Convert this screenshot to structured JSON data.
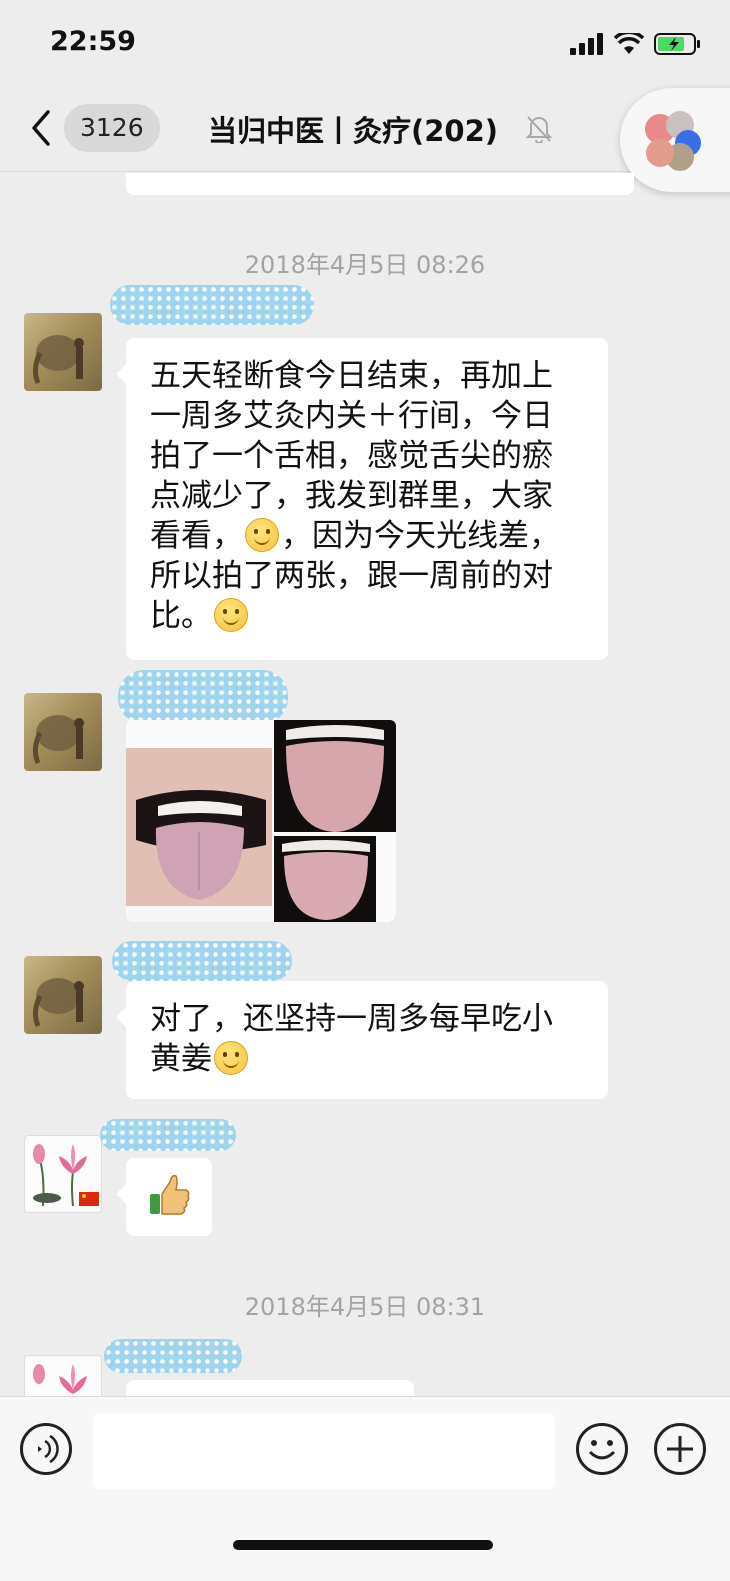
{
  "status_bar": {
    "time": "22:59"
  },
  "nav": {
    "unread_count": "3126",
    "title": "当归中医丨灸疗(202)"
  },
  "chat": {
    "timestamps": [
      "2018年4月5日 08:26",
      "2018年4月5日 08:31"
    ],
    "messages": [
      {
        "lines": [
          "五天轻断食今日结束，再加上",
          "一周多艾灸内关＋行间，今日",
          "拍了一个舌相，感觉舌尖的瘀",
          "点减少了，我发到群里，大家",
          "看看，",
          "，因为今天光线差，",
          "所以拍了两张，跟一周前的对",
          "比。"
        ]
      },
      {
        "lines": [
          "对了，还坚持一周多每早吃小",
          "黄姜"
        ]
      }
    ]
  },
  "colors": {
    "background": "#ededed",
    "bubble": "#ffffff",
    "name_mask": "#9fd4ef"
  },
  "icons": {
    "back": "chevron-left-icon",
    "mute": "bell-slash-icon",
    "voice": "voice-icon",
    "emoji": "smiley-icon",
    "plus": "plus-icon",
    "thumbs_up": "thumbs-up-icon"
  }
}
